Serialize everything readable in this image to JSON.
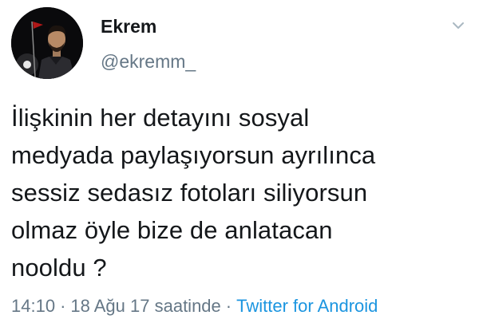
{
  "user": {
    "display_name": "Ekrem",
    "handle": "@ekremm_"
  },
  "tweet": {
    "lines": [
      "İlişkinin her detayını sosyal",
      "medyada paylaşıyorsun ayrılınca",
      "sessiz sedasız fotoları siliyorsun",
      "olmaz öyle bize de anlatacan",
      "nooldu ?"
    ]
  },
  "meta": {
    "time": "14:10",
    "separator": "·",
    "date": "18 Ağu 17 saatinde",
    "source": "Twitter for Android"
  },
  "icons": {
    "caret": "chevron-down-icon",
    "avatar": "profile-photo"
  },
  "colors": {
    "text": "#14171a",
    "secondary": "#657786",
    "link": "#1b95e0"
  }
}
